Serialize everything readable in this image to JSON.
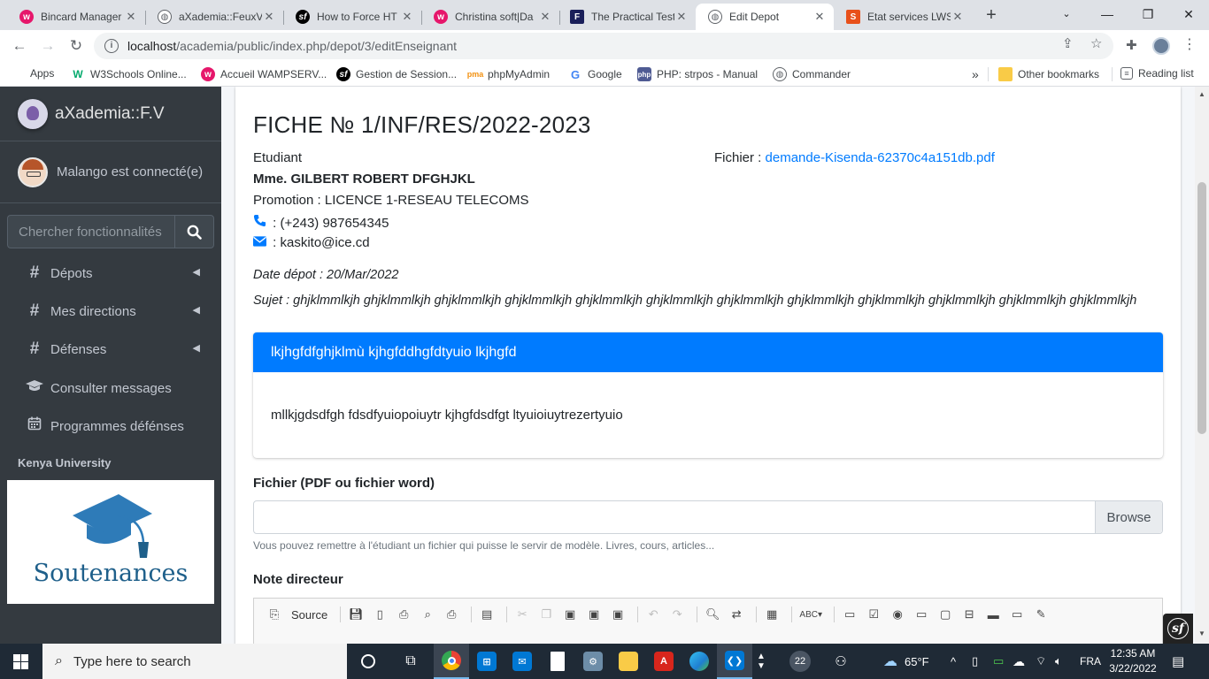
{
  "browser": {
    "tabs": [
      {
        "title": "Bincard Manager",
        "favicon": "wamp-icon",
        "color": "#e6176b",
        "active": false
      },
      {
        "title": "aXademia::FeuxV",
        "favicon": "globe-icon",
        "color": "#5f6368",
        "active": false
      },
      {
        "title": "How to Force HT",
        "favicon": "symfony-icon",
        "color": "#000000",
        "active": false
      },
      {
        "title": "Christina soft|Da",
        "favicon": "wamp-icon",
        "color": "#e6176b",
        "active": false
      },
      {
        "title": "The Practical Test",
        "favicon": "f-icon",
        "color": "#1a1f5a",
        "active": false
      },
      {
        "title": "Edit Depot",
        "favicon": "globe-icon",
        "color": "#5f6368",
        "active": true
      },
      {
        "title": "Etat services LWS",
        "favicon": "lws-icon",
        "color": "#e8501a",
        "active": false
      }
    ],
    "url_host": "localhost",
    "url_path": "/academia/public/index.php/depot/3/editEnseignant",
    "bookmarks": [
      {
        "label": "Apps",
        "icon": "apps-grid-icon"
      },
      {
        "label": "W3Schools Online...",
        "icon": "w3schools-icon"
      },
      {
        "label": "Accueil WAMPSERV...",
        "icon": "wamp-icon"
      },
      {
        "label": "Gestion de Session...",
        "icon": "symfony-icon"
      },
      {
        "label": "phpMyAdmin",
        "icon": "pma-icon"
      },
      {
        "label": "Google",
        "icon": "google-icon"
      },
      {
        "label": "PHP: strpos - Manual",
        "icon": "php-icon"
      },
      {
        "label": "Commander",
        "icon": "globe-icon"
      }
    ],
    "bookmarks_overflow": "»",
    "other_bookmarks": "Other bookmarks",
    "reading_list": "Reading list"
  },
  "sidebar": {
    "brand": "aXademia::F.V",
    "user": "Malango est connecté(e)",
    "search_placeholder": "Chercher fonctionnalités",
    "items": [
      {
        "label": "Dépots",
        "icon": "hash-icon",
        "has_children": true
      },
      {
        "label": "Mes directions",
        "icon": "hash-icon",
        "has_children": true
      },
      {
        "label": "Défenses",
        "icon": "hash-icon",
        "has_children": true
      },
      {
        "label": "Consulter messages",
        "icon": "graduation-cap-icon",
        "has_children": false
      },
      {
        "label": "Programmes défénses",
        "icon": "calendar-icon",
        "has_children": false
      }
    ],
    "university": "Kenya University",
    "university_logo_text": "Soutenances"
  },
  "fiche": {
    "title": "FICHE № 1/INF/RES/2022-2023",
    "role": "Etudiant",
    "name": "Mme. GILBERT ROBERT DFGHJKL",
    "promotion": "Promotion : LICENCE 1-RESEAU TELECOMS",
    "phone": " : (+243) 987654345",
    "email": " : kaskito@ice.cd",
    "fichier_label": "Fichier : ",
    "fichier_link": "demande-Kisenda-62370c4a151db.pdf",
    "date_depot": "Date dépot : 20/Mar/2022",
    "sujet": "Sujet : ghjklmmlkjh ghjklmmlkjh ghjklmmlkjh ghjklmmlkjh ghjklmmlkjh ghjklmmlkjh ghjklmmlkjh ghjklmmlkjh ghjklmmlkjh ghjklmmlkjh ghjklmmlkjh ghjklmmlkjh",
    "card_title": "lkjhgfdfghjklmù kjhgfddhgfdtyuio lkjhgfd",
    "card_body": "mllkjgdsdfgh fdsdfyuiopoiuytr kjhgfdsdfgt ltyuioiuytrezertyuio"
  },
  "form": {
    "file_label": "Fichier (PDF ou fichier word)",
    "browse": "Browse",
    "file_help": "Vous pouvez remettre à l'étudiant un fichier qui puisse le servir de modèle. Livres, cours, articles...",
    "note_label": "Note directeur",
    "editor_source": "Source"
  },
  "colors": {
    "primary": "#007bff",
    "sidebar_bg": "#343a40"
  },
  "taskbar": {
    "search_placeholder": "Type here to search",
    "weather": "65°F",
    "language": "FRA",
    "time": "12:35 AM",
    "date": "3/22/2022",
    "widget_count": "22"
  }
}
